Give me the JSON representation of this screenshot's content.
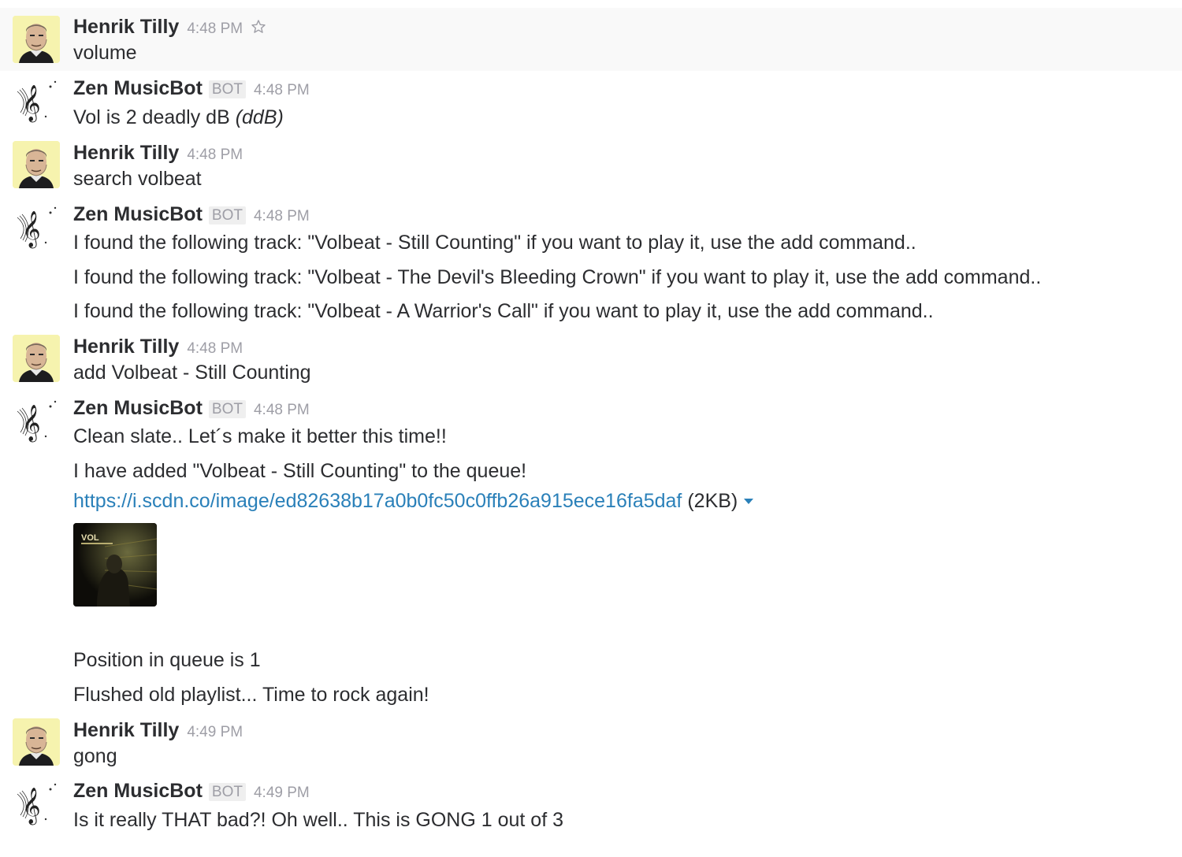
{
  "messages": [
    {
      "author": "Henrik Tilly",
      "time": "4:48 PM",
      "lines": [
        "volume"
      ]
    },
    {
      "author": "Zen MusicBot",
      "bot_tag": "BOT",
      "time": "4:48 PM",
      "lines": [
        "Vol is 2 deadly dB ",
        "(ddB)"
      ]
    },
    {
      "author": "Henrik Tilly",
      "time": "4:48 PM",
      "lines": [
        "search volbeat"
      ]
    },
    {
      "author": "Zen MusicBot",
      "bot_tag": "BOT",
      "time": "4:48 PM",
      "lines": [
        "I found the following track: \"Volbeat - Still Counting\" if you want to play it, use the add command..",
        "I found the following track: \"Volbeat - The Devil's Bleeding Crown\" if you want to play it, use the add command..",
        "I found the following track: \"Volbeat - A Warrior's Call\" if you want to play it, use the add command.."
      ]
    },
    {
      "author": "Henrik Tilly",
      "time": "4:48 PM",
      "lines": [
        "add Volbeat - Still Counting"
      ]
    },
    {
      "author": "Zen MusicBot",
      "bot_tag": "BOT",
      "time": "4:48 PM",
      "lines": [
        "Clean slate..  Let´s make it better this time!!",
        "I have added \"Volbeat - Still Counting\" to the queue!",
        "Position in queue is 1",
        "Flushed old playlist...  Time to rock again!"
      ],
      "attachment": {
        "url": "https://i.scdn.co/image/ed82638b17a0b0fc50c0ffb26a915ece16fa5daf",
        "size": "(2KB)",
        "image_text": "VOL"
      }
    },
    {
      "author": "Henrik Tilly",
      "time": "4:49 PM",
      "lines": [
        "gong"
      ]
    },
    {
      "author": "Zen MusicBot",
      "bot_tag": "BOT",
      "time": "4:49 PM",
      "lines": [
        "Is it really THAT bad?! Oh well.. This is GONG 1 out of 3"
      ]
    }
  ],
  "icons": {
    "star": "star-icon",
    "user_avatar": "user-avatar",
    "bot_avatar": "treble-clef-avatar",
    "caret": "caret-down-icon"
  },
  "colors": {
    "link": "#2a80b9",
    "user_avatar_bg": "#f6f3ae",
    "timestamp": "#9e9ea6"
  }
}
